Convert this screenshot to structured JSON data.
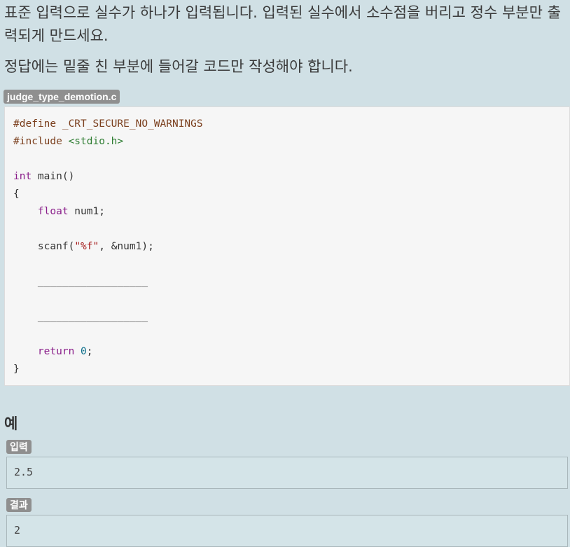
{
  "problem": {
    "description": "표준 입력으로 실수가 하나가 입력됩니다. 입력된 실수에서 소수점을 버리고 정수 부분만 출력되게 만드세요.",
    "instruction": "정답에는 밑줄 친 부분에 들어갈 코드만 작성해야 합니다."
  },
  "code": {
    "filename": "judge_type_demotion.c",
    "lines": {
      "define": "#define _CRT_SECURE_NO_WARNINGS",
      "include_directive": "#include",
      "include_header": "<stdio.h>",
      "int_kw": "int",
      "main_sig": " main()",
      "open_brace": "{",
      "float_kw": "float",
      "decl": " num1;",
      "scanf_start": "scanf(",
      "scanf_fmt": "\"%f\"",
      "scanf_end": ", &num1);",
      "blank1": "__________________",
      "blank2": "__________________",
      "return_kw": "return",
      "return_val": "0",
      "return_end": ";",
      "close_brace": "}"
    }
  },
  "example": {
    "heading": "예",
    "input_label": "입력",
    "input_value": "2.5",
    "result_label": "결과",
    "result_value": "2"
  },
  "colors": {
    "background": "#d0e0e5",
    "badge": "#8f8f8f",
    "keyword": "#8a1e8a",
    "preprocessor": "#7a3e1c",
    "string": "#2e7d32"
  }
}
